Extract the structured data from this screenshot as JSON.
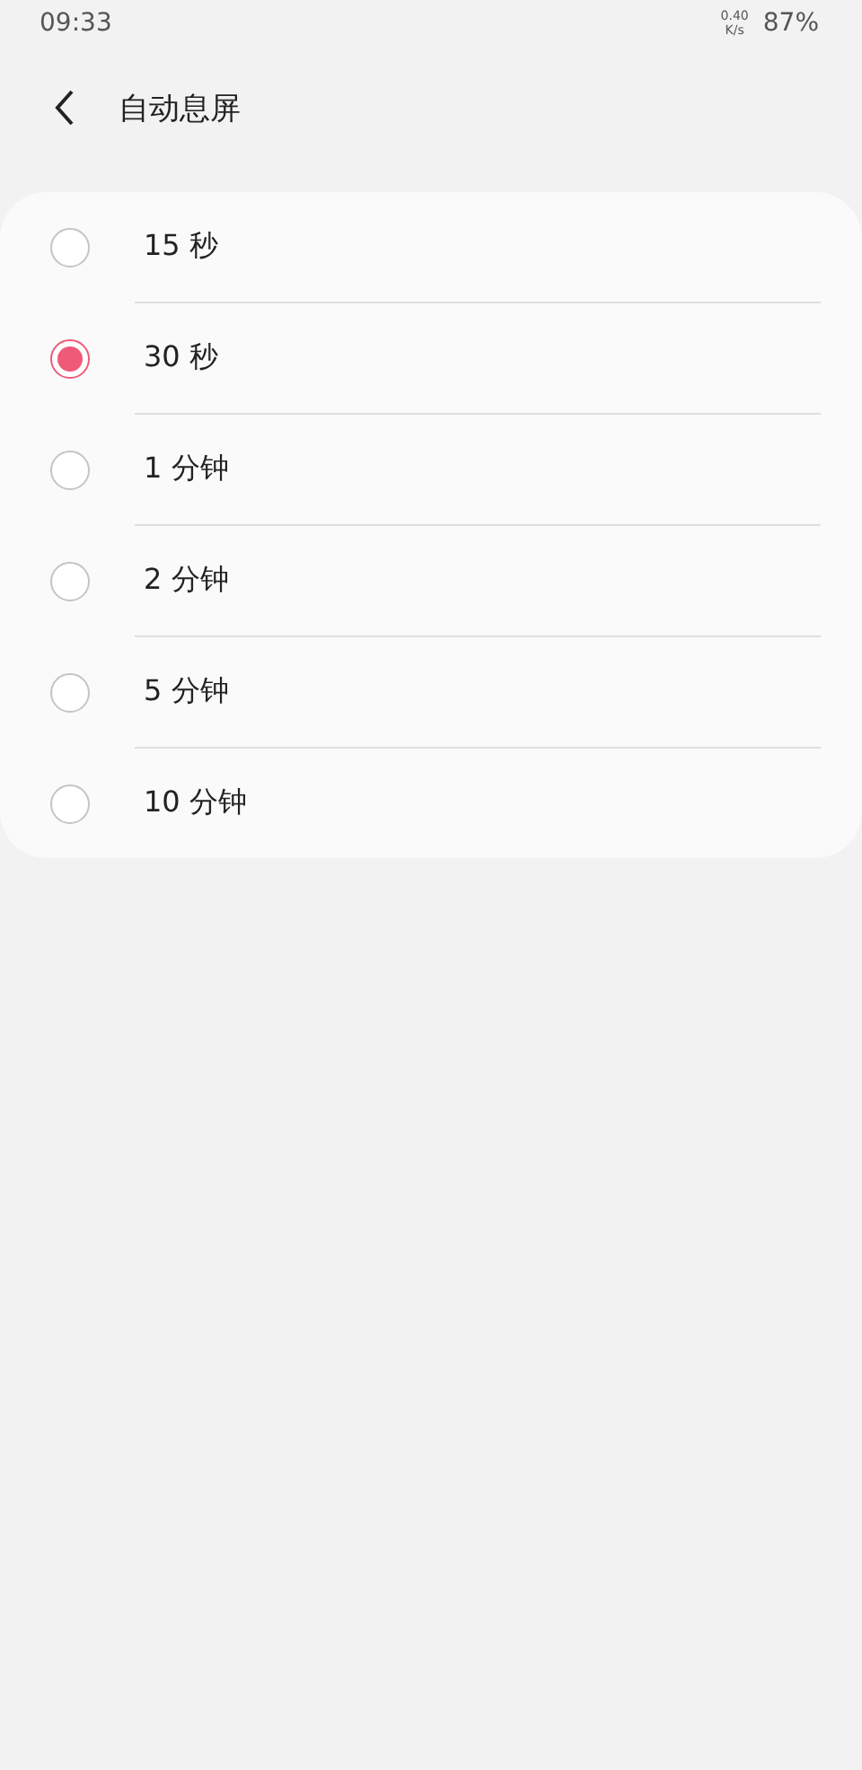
{
  "status_bar": {
    "time": "09:33",
    "net_speed": "0.40",
    "net_unit": "K/s",
    "battery": "87%"
  },
  "header": {
    "title": "自动息屏"
  },
  "options": [
    {
      "label": "15 秒",
      "selected": false
    },
    {
      "label": "30 秒",
      "selected": true
    },
    {
      "label": "1 分钟",
      "selected": false
    },
    {
      "label": "2 分钟",
      "selected": false
    },
    {
      "label": "5 分钟",
      "selected": false
    },
    {
      "label": "10 分钟",
      "selected": false
    }
  ]
}
